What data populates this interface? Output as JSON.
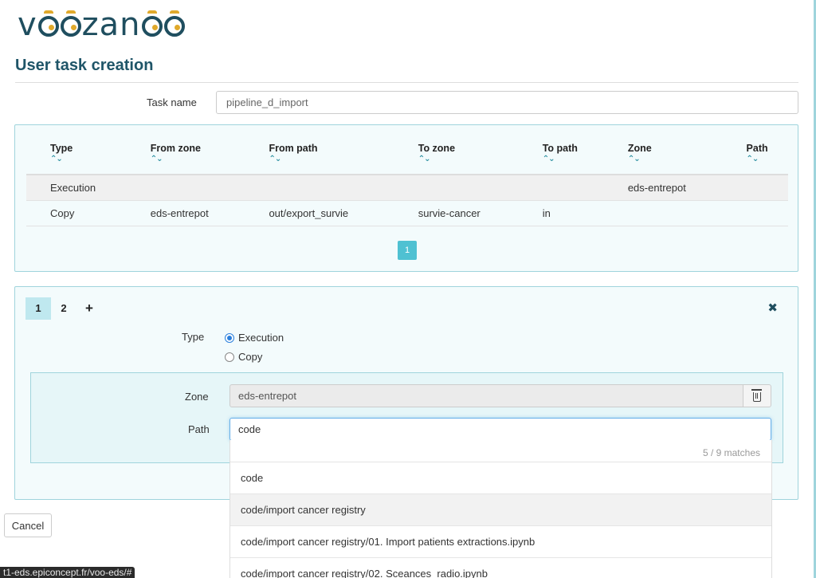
{
  "logo": {
    "text_start": "v",
    "text_end": "zan"
  },
  "page": {
    "title": "User task creation"
  },
  "task_name": {
    "label": "Task name",
    "value": "pipeline_d_import"
  },
  "steps_table": {
    "headers": [
      "Type",
      "From zone",
      "From path",
      "To zone",
      "To path",
      "Zone",
      "Path"
    ],
    "sort_arrows": "⌃⌄",
    "rows": [
      [
        "Execution",
        "",
        "",
        "",
        "",
        "eds-entrepot",
        ""
      ],
      [
        "Copy",
        "eds-entrepot",
        "out/export_survie",
        "survie-cancer",
        "in",
        "",
        ""
      ]
    ],
    "pagination": {
      "current_page": "1"
    }
  },
  "editor": {
    "tabs": [
      {
        "label": "1"
      },
      {
        "label": "2"
      },
      {
        "label": "+"
      }
    ],
    "close_label": "✖",
    "type": {
      "label": "Type",
      "options": [
        "Execution",
        "Copy"
      ],
      "selected": "Execution"
    },
    "zone": {
      "label": "Zone",
      "value": "eds-entrepot"
    },
    "path": {
      "label": "Path",
      "value": "code"
    }
  },
  "autocomplete": {
    "count": "5 / 9 matches",
    "items": [
      "code",
      "code/import cancer registry",
      "code/import cancer registry/01. Import patients extractions.ipynb",
      "code/import cancer registry/02. Sceances_radio.ipynb"
    ]
  },
  "buttons": {
    "cancel": "Cancel"
  },
  "status_bar": {
    "url": "t1-eds.epiconcept.fr/voo-eds/#"
  },
  "colors": {
    "accent": "#4fc1d2",
    "brand": "#1f5568",
    "panel_border": "#9fd4dc"
  }
}
